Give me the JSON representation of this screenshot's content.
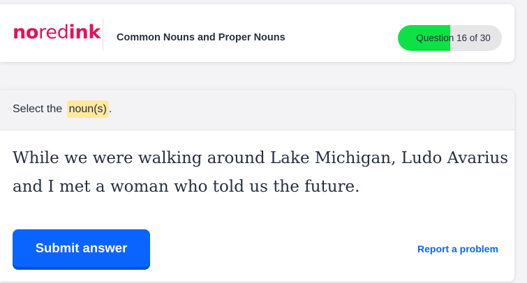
{
  "header": {
    "logo": {
      "part1": "no",
      "part2": "red",
      "part3": "ink"
    },
    "title": "Common Nouns and Proper Nouns",
    "progress": {
      "label": "Question",
      "counter": "16 of 30",
      "fraction": 0.5,
      "fill_color": "#0ee146"
    }
  },
  "prompt": {
    "prefix": "Select the ",
    "highlight": "noun(s)",
    "suffix": "."
  },
  "sentence": "While we were walking around Lake Michigan, Ludo Avarius and I met a woman who told us the future.",
  "actions": {
    "submit_label": "Submit answer",
    "report_label": "Report a problem"
  },
  "colors": {
    "brand": "#e5105a",
    "accent": "#0a64ff",
    "highlight": "#ffe8a0"
  }
}
